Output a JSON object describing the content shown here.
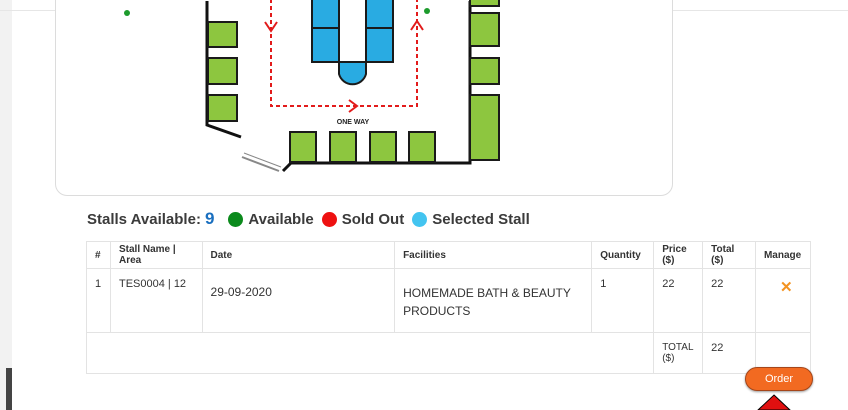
{
  "legend": {
    "stalls_label": "Stalls Available:",
    "stalls_count": "9",
    "items": [
      {
        "label": "Available",
        "color": "#0b8a1c"
      },
      {
        "label": "Sold Out",
        "color": "#ee1111"
      },
      {
        "label": "Selected Stall",
        "color": "#43c4f0"
      }
    ]
  },
  "map": {
    "one_way_label": "ONE WAY"
  },
  "table": {
    "headers": [
      "#",
      "Stall Name | Area",
      "Date",
      "Facilities",
      "Quantity",
      "Price ($)",
      "Total ($)",
      "Manage"
    ],
    "rows": [
      {
        "index": "1",
        "stall": "TES0004 | 12",
        "date": "29-09-2020",
        "facilities": "HOMEMADE BATH & BEAUTY PRODUCTS",
        "quantity": "1",
        "price": "22",
        "total": "22",
        "manage_icon": "close-icon"
      }
    ],
    "total_label": "TOTAL ($)",
    "total_value": "22"
  },
  "actions": {
    "order_label": "Order"
  },
  "colors": {
    "stall_available": "#8dc63f",
    "stall_selected": "#29abe2",
    "path_red": "#e21b1b",
    "order_button": "#f26a21"
  }
}
